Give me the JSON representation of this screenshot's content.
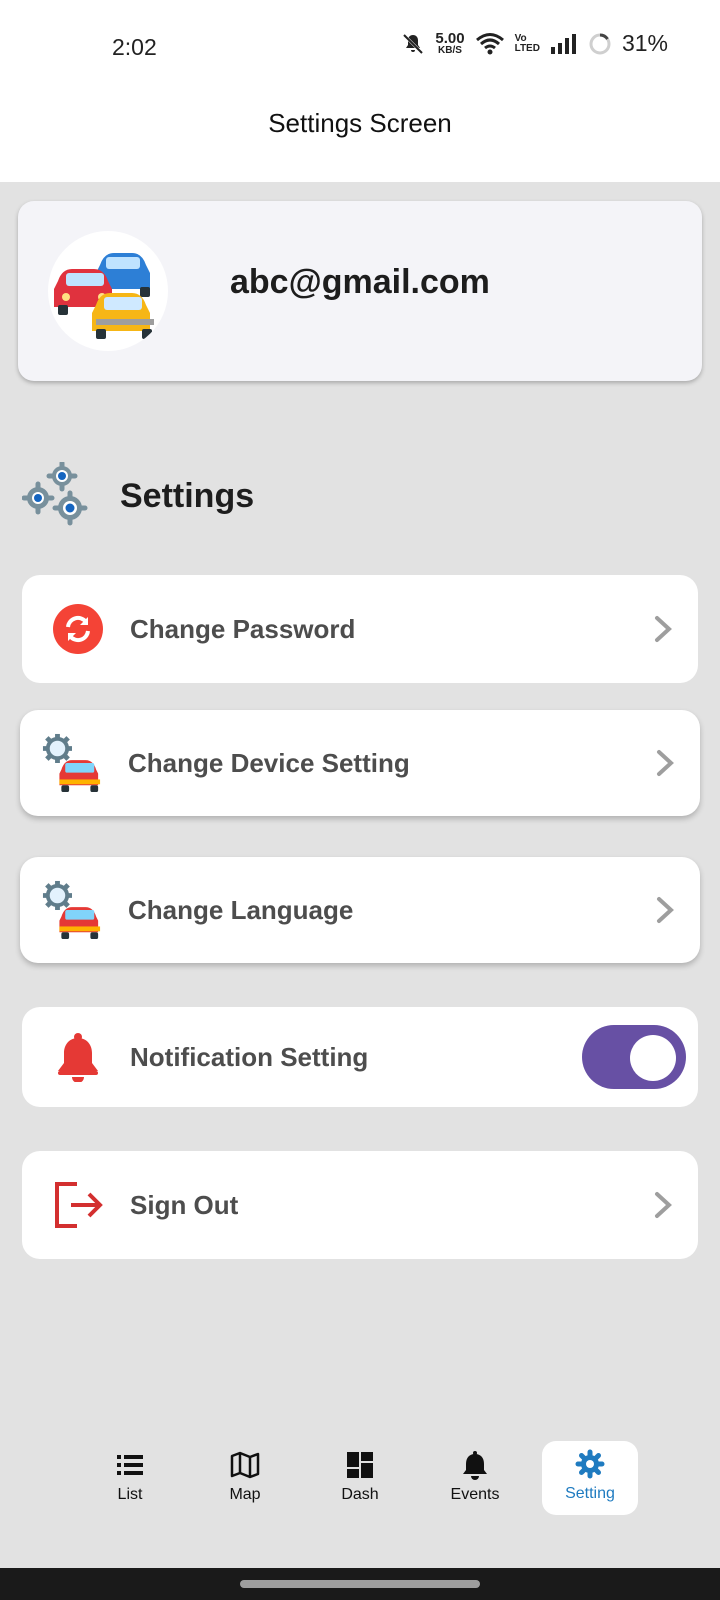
{
  "status_bar": {
    "time": "2:02",
    "net_speed": "5.00",
    "net_unit": "KB/S",
    "volte_top": "Vo",
    "volte_bottom": "LTED",
    "battery": "31%"
  },
  "app_bar": {
    "title": "Settings Screen"
  },
  "profile": {
    "email": "abc@gmail.com"
  },
  "settings_section": {
    "heading": "Settings"
  },
  "items": [
    {
      "label": "Change Password",
      "icon": "refresh-icon"
    },
    {
      "label": "Change Device Setting",
      "icon": "car-gear-icon"
    },
    {
      "label": "Change Language",
      "icon": "car-gear-icon"
    },
    {
      "label": "Notification Setting",
      "icon": "bell-icon",
      "toggle_on": true
    },
    {
      "label": "Sign Out",
      "icon": "sign-out-icon"
    }
  ],
  "bottom_nav": {
    "items": [
      {
        "label": "List",
        "icon": "list-icon"
      },
      {
        "label": "Map",
        "icon": "map-icon"
      },
      {
        "label": "Dash",
        "icon": "dashboard-icon"
      },
      {
        "label": "Events",
        "icon": "bell-icon"
      },
      {
        "label": "Setting",
        "icon": "gear-icon",
        "active": true
      }
    ]
  },
  "colors": {
    "accent": "#1f7bc0",
    "toggle": "#6750a4",
    "danger": "#e53935"
  }
}
